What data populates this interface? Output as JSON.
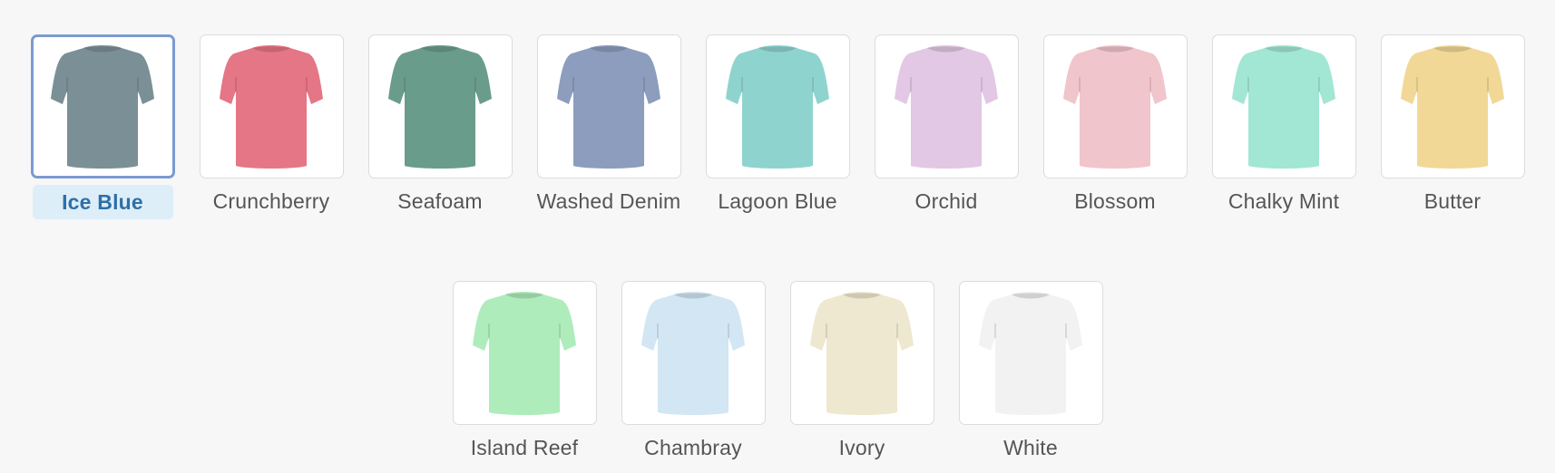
{
  "color_picker": {
    "selected": "Ice Blue",
    "rows": [
      [
        {
          "label": "Ice Blue",
          "color": "#7b8f96",
          "selected": true
        },
        {
          "label": "Crunchberry",
          "color": "#e57685",
          "selected": false
        },
        {
          "label": "Seafoam",
          "color": "#6a9c8c",
          "selected": false
        },
        {
          "label": "Washed Denim",
          "color": "#8c9dbe",
          "selected": false
        },
        {
          "label": "Lagoon Blue",
          "color": "#8fd3cf",
          "selected": false
        },
        {
          "label": "Orchid",
          "color": "#e2c8e4",
          "selected": false
        },
        {
          "label": "Blossom",
          "color": "#f1c5cc",
          "selected": false
        },
        {
          "label": "Chalky Mint",
          "color": "#a2e6d4",
          "selected": false
        },
        {
          "label": "Butter",
          "color": "#f1d896",
          "selected": false
        }
      ],
      [
        {
          "label": "Island Reef",
          "color": "#aeecbc",
          "selected": false
        },
        {
          "label": "Chambray",
          "color": "#d2e6f3",
          "selected": false
        },
        {
          "label": "Ivory",
          "color": "#efe8d0",
          "selected": false
        },
        {
          "label": "White",
          "color": "#f2f2f2",
          "selected": false
        }
      ]
    ]
  }
}
